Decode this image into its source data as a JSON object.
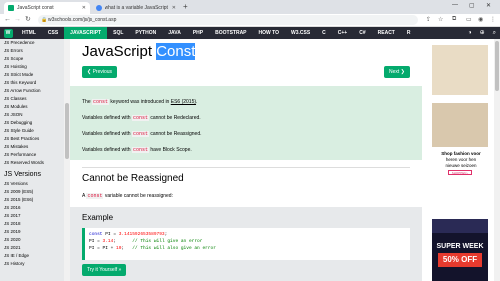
{
  "browser": {
    "tabs": [
      {
        "label": "JavaScript const",
        "active": true
      },
      {
        "label": "what is a variable JavaScript - Go",
        "active": false
      }
    ],
    "url": "w3schools.com/js/js_const.asp"
  },
  "topnav": {
    "logo": "W",
    "items": [
      "HTML",
      "CSS",
      "JAVASCRIPT",
      "SQL",
      "PYTHON",
      "JAVA",
      "PHP",
      "BOOTSTRAP",
      "HOW TO",
      "W3.CSS",
      "C",
      "C++",
      "C#",
      "REACT",
      "R"
    ],
    "active": "JAVASCRIPT"
  },
  "sidebar": {
    "items_top": [
      "JS Precedence",
      "JS Errors",
      "JS Scope",
      "JS Hoisting",
      "JS Strict Mode",
      "JS this Keyword",
      "JS Arrow Function",
      "JS Classes",
      "JS Modules",
      "JS JSON",
      "JS Debugging",
      "JS Style Guide",
      "JS Best Practices",
      "JS Mistakes",
      "JS Performance",
      "JS Reserved Words"
    ],
    "heading": "JS Versions",
    "items_bottom": [
      "JS Versions",
      "JS 2009 (ES5)",
      "JS 2015 (ES6)",
      "JS 2016",
      "JS 2017",
      "JS 2018",
      "JS 2019",
      "JS 2020",
      "JS 2021",
      "JS IE / Edge",
      "JS History"
    ]
  },
  "main": {
    "title_prefix": "JavaScript ",
    "title_highlight": "Const",
    "prev_label": "❮ Previous",
    "next_label": "Next ❯",
    "note": {
      "l1a": "The ",
      "l1kw": "const",
      "l1b": " keyword was introduced in ",
      "l1link": "ES6 (2015)",
      "l1c": ".",
      "l2a": "Variables defined with ",
      "l2kw": "const",
      "l2b": " cannot be Redeclared.",
      "l3a": "Variables defined with ",
      "l3kw": "const",
      "l3b": " cannot be Reassigned.",
      "l4a": "Variables defined with ",
      "l4kw": "const",
      "l4b": " have Block Scope."
    },
    "section_title": "Cannot be Reassigned",
    "section_para_a": "A ",
    "section_para_kw": "const",
    "section_para_b": " variable cannot be reassigned:",
    "example": {
      "title": "Example",
      "line1_kw": "const",
      "line1_rest": " PI = ",
      "line1_num": "3.141592653589793",
      "line1_end": ";",
      "line2_a": "PI = ",
      "line2_num": "3.14",
      "line2_b": ";      ",
      "line2_cm": "// This will give an error",
      "line3_a": "PI = PI + ",
      "line3_num": "10",
      "line3_b": ";   ",
      "line3_cm": "// This will also give an error",
      "button": "Try it Yourself »"
    }
  },
  "ads": {
    "text1": "Shop fashion voor",
    "text2": "heren voor hen",
    "text3": "nieuwe seizoen",
    "button": "SHOPPEN ›",
    "sale1": "SUPER WEEK",
    "sale2": "50% OFF"
  },
  "colors": {
    "accent": "#04aa6d",
    "nav_bg": "#282a35",
    "note_bg": "#d9eee1"
  }
}
